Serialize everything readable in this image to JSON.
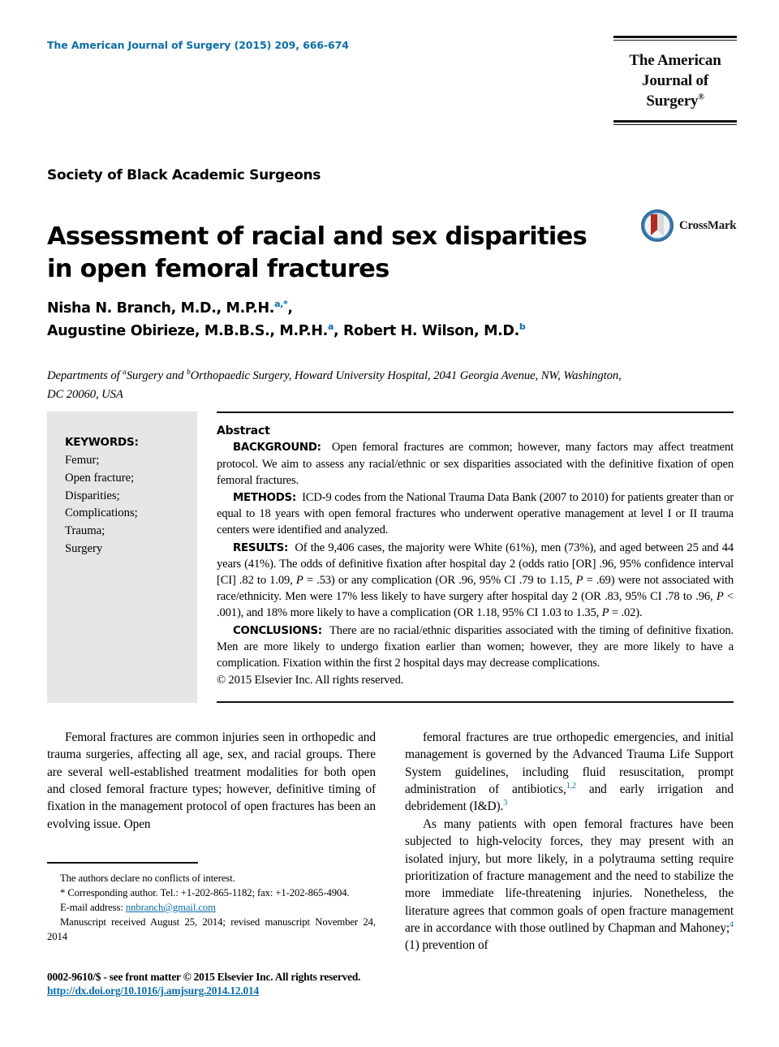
{
  "header": {
    "running_head": "The American Journal of Surgery (2015) 209, 666-674",
    "accent_color": "#0b6ea8",
    "logo": {
      "line1": "The American",
      "line2": "Journal of Surgery",
      "trademark": "®"
    }
  },
  "society": "Society of Black Academic Surgeons",
  "title": "Assessment of racial and sex disparities in open femoral fractures",
  "crossmark": {
    "label": "CrossMark",
    "icon": "crossmark-icon"
  },
  "authors": {
    "line1_name": "Nisha N. Branch, M.D., M.P.H.",
    "line1_sup": "a,*",
    "line1_tail": ",",
    "line2_name1": "Augustine Obirieze, M.B.B.S., M.P.H.",
    "line2_sup1": "a",
    "line2_mid": ", Robert H. Wilson, M.D.",
    "line2_sup2": "b"
  },
  "affiliation": {
    "pre": "Departments of ",
    "sup_a": "a",
    "mid1": "Surgery and ",
    "sup_b": "b",
    "rest": "Orthopaedic Surgery, Howard University Hospital, 2041 Georgia Avenue, NW, Washington, DC 20060, USA"
  },
  "keywords": {
    "title": "KEYWORDS:",
    "items": [
      "Femur;",
      "Open fracture;",
      "Disparities;",
      "Complications;",
      "Trauma;",
      "Surgery"
    ]
  },
  "abstract": {
    "heading": "Abstract",
    "sections": [
      {
        "label": "BACKGROUND:",
        "text": "Open femoral fractures are common; however, many factors may affect treatment protocol. We aim to assess any racial/ethnic or sex disparities associated with the definitive fixation of open femoral fractures."
      },
      {
        "label": "METHODS:",
        "text": "ICD-9 codes from the National Trauma Data Bank (2007 to 2010) for patients greater than or equal to 18 years with open femoral fractures who underwent operative management at level I or II trauma centers were identified and analyzed."
      },
      {
        "label": "RESULTS:",
        "text_parts": [
          "Of the 9,406 cases, the majority were White (61%), men (73%), and aged between 25 and 44 years (41%). The odds of definitive fixation after hospital day 2 (odds ratio [OR] .96, 95% confidence interval [CI] .82 to 1.09, ",
          "P",
          " = .53) or any complication (OR .96, 95% CI .79 to 1.15, ",
          "P",
          " = .69) were not associated with race/ethnicity. Men were 17% less likely to have surgery after hospital day 2 (OR .83, 95% CI .78 to .96, ",
          "P",
          " < .001), and 18% more likely to have a complication (OR 1.18, 95% CI 1.03 to 1.35, ",
          "P",
          " = .02)."
        ]
      },
      {
        "label": "CONCLUSIONS:",
        "text": "There are no racial/ethnic disparities associated with the timing of definitive fixation. Men are more likely to undergo fixation earlier than women; however, they are more likely to have a complication. Fixation within the first 2 hospital days may decrease complications."
      }
    ],
    "copyright": "© 2015 Elsevier Inc. All rights reserved."
  },
  "body": {
    "left_column": [
      "Femoral fractures are common injuries seen in orthopedic and trauma surgeries, affecting all age, sex, and racial groups. There are several well-established treatment modalities for both open and closed femoral fracture types; however, definitive timing of fixation in the management protocol of open fractures has been an evolving issue. Open"
    ],
    "right_column_para1_parts": [
      "femoral fractures are true orthopedic emergencies, and initial management is governed by the Advanced Trauma Life Support System guidelines, including fluid resuscitation, prompt administration of antibiotics,",
      "1,2",
      " and early irrigation and debridement (I&D).",
      "3"
    ],
    "right_column_para2_parts": [
      "As many patients with open femoral fractures have been subjected to high-velocity forces, they may present with an isolated injury, but more likely, in a polytrauma setting require prioritization of fracture management and the need to stabilize the more immediate life-threatening injuries. Nonetheless, the literature agrees that common goals of open fracture management are in accordance with those outlined by Chapman and Mahoney;",
      "4",
      " (1) prevention of"
    ]
  },
  "footnotes": {
    "conflicts": "The authors declare no conflicts of interest.",
    "corresponding": "* Corresponding author. Tel.: +1-202-865-1182; fax: +1-202-865-4904.",
    "email_label": "E-mail address:",
    "email": "nnbranch@gmail.com",
    "manuscript": "Manuscript received August 25, 2014; revised manuscript November 24, 2014"
  },
  "footer": {
    "front_matter": "0002-9610/$ - see front matter © 2015 Elsevier Inc. All rights reserved.",
    "doi": "http://dx.doi.org/10.1016/j.amjsurg.2014.12.014"
  }
}
